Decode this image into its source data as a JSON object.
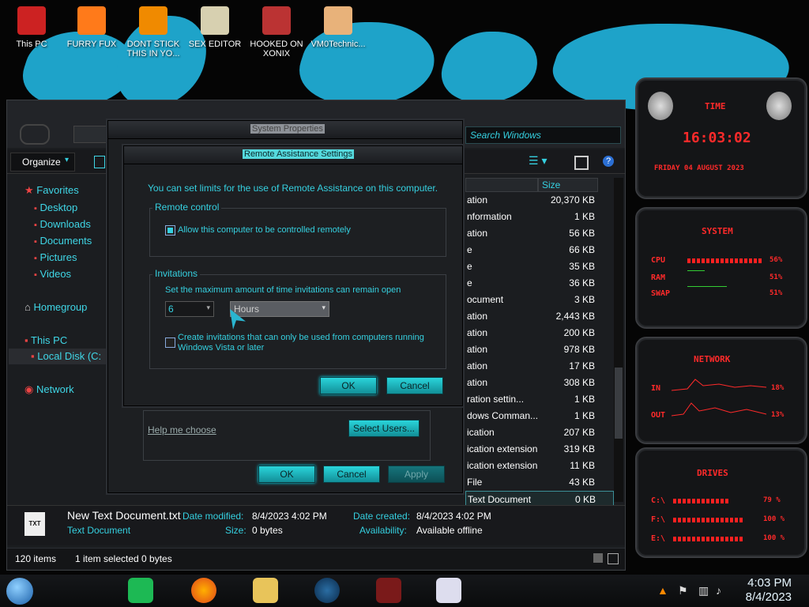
{
  "desktop_icons": [
    {
      "label": "This PC",
      "name": "this-pc-icon",
      "color": "#c22"
    },
    {
      "label": "FURRY FUX",
      "name": "firefox-icon",
      "color": "#ff7a1a"
    },
    {
      "label": "DONT STICK THIS IN YO...",
      "name": "vlc-icon",
      "color": "#f08a00"
    },
    {
      "label": "SEX EDITOR",
      "name": "hxd-icon",
      "color": "#d7d0b0"
    },
    {
      "label": "HOOKED ON XONIX",
      "name": "xonix-icon",
      "color": "#b33"
    },
    {
      "label": "VM0Technic...",
      "name": "doctor-icon",
      "color": "#e8b27a"
    }
  ],
  "explorer": {
    "search_placeholder": "Search Windows",
    "organize": "Organize",
    "column_size": "Size",
    "nav": {
      "favorites": "Favorites",
      "favorites_items": [
        "Desktop",
        "Downloads",
        "Documents",
        "Pictures",
        "Videos"
      ],
      "homegroup": "Homegroup",
      "this_pc": "This PC",
      "local_disk": "Local Disk (C:",
      "network": "Network"
    },
    "rows": [
      {
        "type": "ation",
        "size": "20,370 KB"
      },
      {
        "type": "nformation",
        "size": "1 KB"
      },
      {
        "type": "ation",
        "size": "56 KB"
      },
      {
        "type": "e",
        "size": "66 KB"
      },
      {
        "type": "e",
        "size": "35 KB"
      },
      {
        "type": "e",
        "size": "36 KB"
      },
      {
        "type": "ocument",
        "size": "3 KB"
      },
      {
        "type": "ation",
        "size": "2,443 KB"
      },
      {
        "type": "ation",
        "size": "200 KB"
      },
      {
        "type": "ation",
        "size": "978 KB"
      },
      {
        "type": "ation",
        "size": "17 KB"
      },
      {
        "type": "ation",
        "size": "308 KB"
      },
      {
        "type": "ration settin...",
        "size": "1 KB"
      },
      {
        "type": "dows Comman...",
        "size": "1 KB"
      },
      {
        "type": "ication",
        "size": "207 KB"
      },
      {
        "type": "ication extension",
        "size": "319 KB"
      },
      {
        "type": "ication extension",
        "size": "11 KB"
      },
      {
        "type": "File",
        "size": "43 KB"
      },
      {
        "type": "Text Document",
        "size": "0 KB"
      }
    ],
    "details": {
      "filename": "New Text Document.txt",
      "filetype": "Text Document",
      "date_modified_label": "Date modified:",
      "date_modified": "8/4/2023 4:02 PM",
      "size_label": "Size:",
      "size": "0 bytes",
      "date_created_label": "Date created:",
      "date_created": "8/4/2023 4:02 PM",
      "availability_label": "Availability:",
      "availability": "Available offline",
      "icon_text": "TXT"
    },
    "status": {
      "items": "120 items",
      "selected": "1 item selected  0 bytes"
    }
  },
  "system_properties": {
    "title": "System Properties",
    "help_link": "Help me choose",
    "select_users": "Select Users...",
    "ok": "OK",
    "cancel": "Cancel",
    "apply": "Apply"
  },
  "remote_assistance": {
    "title": "Remote Assistance Settings",
    "intro": "You can set limits for the use of Remote Assistance on this computer.",
    "remote_control_legend": "Remote control",
    "allow_control": "Allow this computer to be controlled remotely",
    "invitations_legend": "Invitations",
    "invitations_text": "Set the maximum amount of time invitations can remain open",
    "amount": "6",
    "unit": "Hours",
    "vista_line1": "Create invitations that can only be used from computers running",
    "vista_line2": "Windows Vista or later",
    "ok": "OK",
    "cancel": "Cancel"
  },
  "gadgets": {
    "time_title": "TIME",
    "time": "16:03:02",
    "date": "FRIDAY 04 AUGUST 2023",
    "system_title": "SYSTEM",
    "cpu_label": "CPU",
    "cpu": "56%",
    "cpu_fraction": 0.56,
    "ram_label": "RAM",
    "ram": "51%",
    "ram_fraction": 0.51,
    "swap_label": "SWAP",
    "swap": "51%",
    "swap_fraction": 0.51,
    "network_title": "NETWORK",
    "in_label": "IN",
    "in_value": "18%",
    "out_label": "OUT",
    "out_value": "13%",
    "drives_title": "DRIVES",
    "drives": [
      {
        "label": "C:\\",
        "value": "79 %",
        "fraction": 0.79
      },
      {
        "label": "F:\\",
        "value": "100 %",
        "fraction": 1.0
      },
      {
        "label": "E:\\",
        "value": "100 %",
        "fraction": 1.0
      }
    ]
  },
  "taskbar": {
    "time": "4:03 PM",
    "date": "8/4/2023"
  },
  "colors": {
    "accent": "#35d0e0",
    "button": "#1fc2cc",
    "gadget_red": "#ff2a2a",
    "brush": "#1ea3c9"
  }
}
